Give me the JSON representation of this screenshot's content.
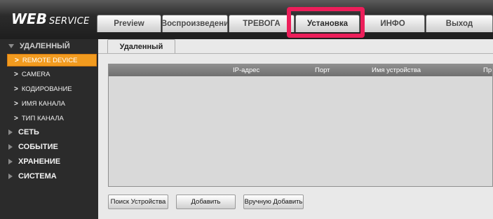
{
  "brand": {
    "part1": "WEB",
    "part2": "SERVICE"
  },
  "tabs": [
    {
      "label": "Preview"
    },
    {
      "label": "Воспроизведени"
    },
    {
      "label": "ТРЕВОГА"
    },
    {
      "label": "Установка"
    },
    {
      "label": "ИНФО"
    },
    {
      "label": "Выход"
    }
  ],
  "active_tab": "Установка",
  "highlight_color": "#ec1e5a",
  "sidebar": {
    "sections": [
      {
        "label": "УДАЛЕННЫЙ",
        "expanded": true
      },
      {
        "label": "СЕТЬ",
        "expanded": false
      },
      {
        "label": "СОБЫТИЕ",
        "expanded": false
      },
      {
        "label": "ХРАНЕНИЕ",
        "expanded": false
      },
      {
        "label": "СИСТЕМА",
        "expanded": false
      }
    ],
    "subitems": [
      {
        "label": "REMOTE DEVICE",
        "selected": true
      },
      {
        "label": "CAMERA"
      },
      {
        "label": "КОДИРОВАНИЕ"
      },
      {
        "label": "ИМЯ КАНАЛА"
      },
      {
        "label": "ТИП КАНАЛА"
      }
    ],
    "arrow_glyph": ">",
    "selected_color": "#f29b1f"
  },
  "main": {
    "subtab": "Удаленный",
    "table": {
      "columns": [
        "IP-адрес",
        "Порт",
        "Имя устройства",
        "Пр"
      ],
      "rows": []
    },
    "buttons": {
      "search": "Поиск Устройства",
      "add": "Добавить",
      "manual_add": "Вручную Добавить"
    }
  }
}
